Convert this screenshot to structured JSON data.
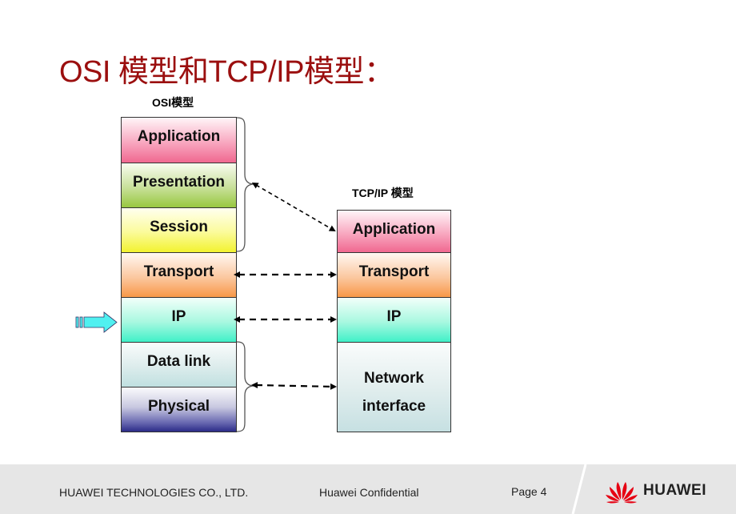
{
  "slide": {
    "title": "OSI 模型和TCP/IP模型："
  },
  "osi": {
    "heading": "OSI模型",
    "layers": [
      {
        "label": "Application",
        "color": "#f06890"
      },
      {
        "label": "Presentation",
        "color": "#98c840"
      },
      {
        "label": "Session",
        "color": "#f2f230"
      },
      {
        "label": "Transport",
        "color": "#f89848"
      },
      {
        "label": "IP",
        "color": "#40f0c8"
      },
      {
        "label": "Data link",
        "color": "#c0e0e0"
      },
      {
        "label": "Physical",
        "color": "#2c2c88"
      }
    ]
  },
  "tcpip": {
    "heading": "TCP/IP 模型",
    "layers": [
      {
        "label": "Application",
        "color": "#f06890"
      },
      {
        "label": "Transport",
        "color": "#f89848"
      },
      {
        "label": "IP",
        "color": "#40f0c8"
      },
      {
        "label_line1": "Network",
        "label_line2": "interface",
        "color": "#c6e0e2"
      }
    ]
  },
  "mappings": [
    {
      "from": "OSI Application+Presentation+Session",
      "to": "TCP/IP Application"
    },
    {
      "from": "OSI Transport",
      "to": "TCP/IP Transport"
    },
    {
      "from": "OSI IP",
      "to": "TCP/IP IP"
    },
    {
      "from": "OSI Data link+Physical",
      "to": "TCP/IP Network interface"
    }
  ],
  "pointer": {
    "icon": "arrow-right-icon",
    "target": "OSI IP",
    "color": "#50f0f0"
  },
  "footer": {
    "company": "HUAWEI TECHNOLOGIES CO., LTD.",
    "confidential": "Huawei Confidential",
    "page": "Page 4",
    "logo_text": "HUAWEI",
    "logo_icon": "huawei-flower-icon",
    "logo_color": "#e60012"
  }
}
